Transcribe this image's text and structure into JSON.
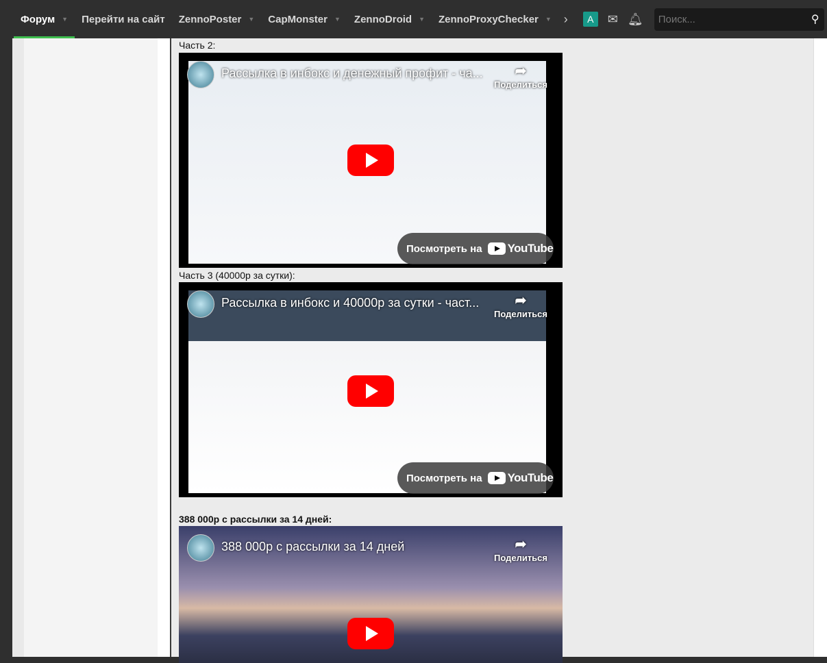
{
  "nav": {
    "items": [
      {
        "label": "Форум",
        "caret": true
      },
      {
        "label": "Перейти на сайт",
        "caret": false
      },
      {
        "label": "ZennoPoster",
        "caret": true
      },
      {
        "label": "CapMonster",
        "caret": true
      },
      {
        "label": "ZennoDroid",
        "caret": true
      },
      {
        "label": "ZennoProxyChecker",
        "caret": true
      }
    ],
    "more": "›",
    "avatar": "A",
    "search_placeholder": "Поиск..."
  },
  "post": {
    "videos": [
      {
        "label": "Часть 2:",
        "title": "Рассылка в инбокс и денежный профит - ча...",
        "share": "Поделиться",
        "watch": "Посмотреть на",
        "yt": "YouTube"
      },
      {
        "label": "Часть 3 (40000р за сутки):",
        "title": "Рассылка в инбокс и 40000р за сутки - част...",
        "share": "Поделиться",
        "watch": "Посмотреть на",
        "yt": "YouTube"
      },
      {
        "label": "388 000р с рассылки за 14 дней:",
        "title": "388 000р с рассылки за 14 дней",
        "share": "Поделиться"
      }
    ]
  },
  "colors": {
    "accent": "#3fbf4f",
    "avatar": "#179a8a",
    "youtube": "#ff0000"
  }
}
